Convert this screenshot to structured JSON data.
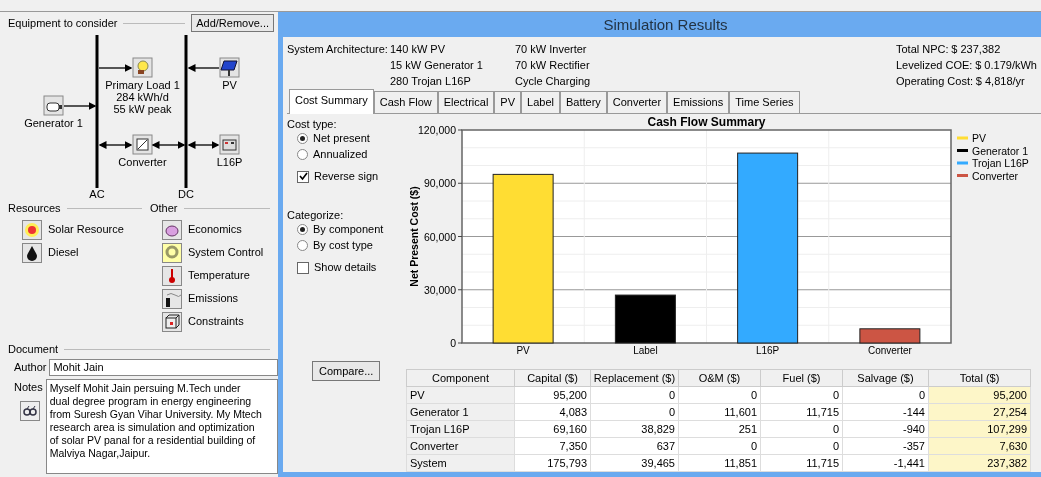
{
  "equipment": {
    "title": "Equipment to consider",
    "button": "Add/Remove...",
    "buses": [
      {
        "label": "AC"
      },
      {
        "label": "DC"
      }
    ],
    "nodes": [
      {
        "kind": "load",
        "label": "Primary Load 1",
        "details": [
          "284 kWh/d",
          "55 kW peak"
        ]
      },
      {
        "kind": "pv",
        "label": "PV"
      },
      {
        "kind": "generator",
        "label": "Generator 1"
      },
      {
        "kind": "converter",
        "label": "Converter"
      },
      {
        "kind": "battery",
        "label": "L16P"
      }
    ]
  },
  "resources": {
    "title": "Resources",
    "items": [
      {
        "kind": "solar",
        "label": "Solar Resource"
      },
      {
        "kind": "diesel",
        "label": "Diesel"
      }
    ]
  },
  "other": {
    "title": "Other",
    "items": [
      {
        "kind": "economics",
        "label": "Economics"
      },
      {
        "kind": "control",
        "label": "System Control"
      },
      {
        "kind": "temperature",
        "label": "Temperature"
      },
      {
        "kind": "emissions",
        "label": "Emissions"
      },
      {
        "kind": "constraints",
        "label": "Constraints"
      }
    ]
  },
  "document": {
    "title": "Document",
    "author_label": "Author",
    "author": "Mohit Jain",
    "notes_label": "Notes",
    "notes": "Myself Mohit Jain persuing M.Tech under dual degree program in energy engineering from Suresh Gyan Vihar University. My Mtech research area is  simulation and optimization of solar PV panal for a residential building of Malviya Nagar,Jaipur."
  },
  "results": {
    "title": "Simulation Results",
    "architecture": {
      "label": "System Architecture:",
      "column_1": [
        "140 kW PV",
        "15 kW Generator 1",
        "280 Trojan L16P"
      ],
      "column_2": [
        "70 kW Inverter",
        "70 kW Rectifier",
        "Cycle Charging"
      ]
    },
    "totals": [
      {
        "label": "Total NPC:",
        "value": "$ 237,382"
      },
      {
        "label": "Levelized COE:",
        "value": "$ 0.179/kWh"
      },
      {
        "label": "Operating Cost:",
        "value": "$ 4,818/yr"
      }
    ],
    "tabs": [
      {
        "label": "Cost Summary",
        "selected": true
      },
      {
        "label": "Cash Flow",
        "selected": false
      },
      {
        "label": "Electrical",
        "selected": false
      },
      {
        "label": "PV",
        "selected": false
      },
      {
        "label": "Label",
        "selected": false
      },
      {
        "label": "Battery",
        "selected": false
      },
      {
        "label": "Converter",
        "selected": false
      },
      {
        "label": "Emissions",
        "selected": false
      },
      {
        "label": "Time Series",
        "selected": false
      }
    ],
    "options": [
      {
        "title": "Cost type:",
        "items": [
          {
            "kind": "radio",
            "label": "Net present",
            "selected": true
          },
          {
            "kind": "radio",
            "label": "Annualized",
            "selected": false
          },
          {
            "kind": "checkbox",
            "label": "Reverse sign",
            "checked": true
          }
        ]
      },
      {
        "title": "Categorize:",
        "items": [
          {
            "kind": "radio",
            "label": "By component",
            "selected": true
          },
          {
            "kind": "radio",
            "label": "By cost type",
            "selected": false
          },
          {
            "kind": "checkbox",
            "label": "Show details",
            "checked": false
          }
        ]
      }
    ],
    "compare_button": "Compare...",
    "chart_data": {
      "type": "bar",
      "title": "Cash Flow Summary",
      "ylabel": "Net Present Cost ($)",
      "categories": [
        "PV",
        "Label",
        "L16P",
        "Converter"
      ],
      "series": [
        {
          "name": "PV",
          "color": "#ffdd33",
          "values": [
            95000,
            null,
            null,
            null
          ]
        },
        {
          "name": "Generator 1",
          "color": "#000000",
          "values": [
            null,
            27000,
            null,
            null
          ]
        },
        {
          "name": "Trojan L16P",
          "color": "#33aaff",
          "values": [
            null,
            null,
            107000,
            null
          ]
        },
        {
          "name": "Converter",
          "color": "#cc5544",
          "values": [
            null,
            null,
            null,
            8000
          ]
        }
      ],
      "grid": true,
      "legend": true,
      "ylim": [
        0,
        120000
      ],
      "yticks": [
        {
          "value": 0,
          "label": "0"
        },
        {
          "value": 30000,
          "label": "30,000"
        },
        {
          "value": 60000,
          "label": "60,000"
        },
        {
          "value": 90000,
          "label": "90,000"
        },
        {
          "value": 120000,
          "label": "120,000"
        }
      ]
    },
    "table": {
      "columns": [
        {
          "label": "Component",
          "highlighted": false
        },
        {
          "label": "Capital ($)",
          "highlighted": false
        },
        {
          "label": "Replacement ($)",
          "highlighted": false
        },
        {
          "label": "O&M ($)",
          "highlighted": false
        },
        {
          "label": "Fuel ($)",
          "highlighted": false
        },
        {
          "label": "Salvage ($)",
          "highlighted": false
        },
        {
          "label": "Total ($)",
          "highlighted": true
        }
      ],
      "rows": [
        [
          "PV",
          "95,200",
          "0",
          "0",
          "0",
          "0",
          "95,200"
        ],
        [
          "Generator 1",
          "4,083",
          "0",
          "11,601",
          "11,715",
          "-144",
          "27,254"
        ],
        [
          "Trojan L16P",
          "69,160",
          "38,829",
          "251",
          "0",
          "-940",
          "107,299"
        ],
        [
          "Converter",
          "7,350",
          "637",
          "0",
          "0",
          "-357",
          "7,630"
        ],
        [
          "System",
          "175,793",
          "39,465",
          "11,851",
          "11,715",
          "-1,441",
          "237,382"
        ]
      ]
    }
  }
}
